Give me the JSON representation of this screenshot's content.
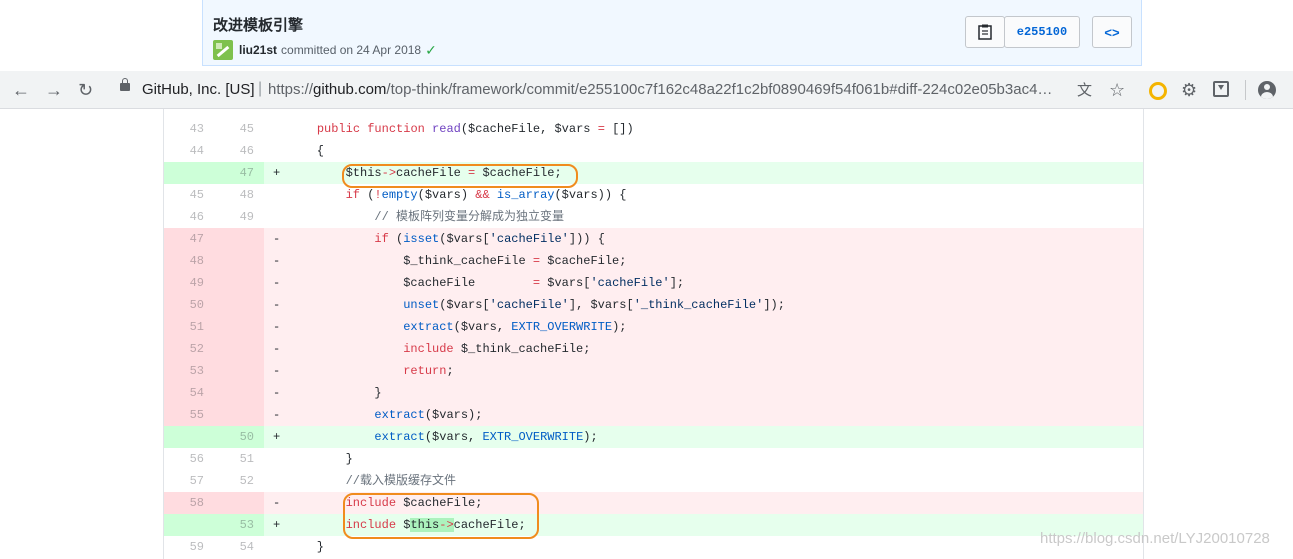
{
  "commit": {
    "title": "改进模板引擎",
    "author": "liu21st",
    "action": "committed on 24 Apr 2018",
    "sha": "e255100",
    "browse_label": "<>"
  },
  "browser": {
    "origin": "GitHub, Inc. [US]",
    "separator": "|",
    "url_prefix": "https://",
    "url_host": "github.com",
    "url_path": "/top-think/framework/commit/e255100c7f162c48a22f1c2bf0890469f54f061b#diff-224c02e05b3ac4…"
  },
  "diff": {
    "rows": [
      {
        "type": "ctx",
        "old": "43",
        "new": "45",
        "sign": "",
        "code": "    <span class=\"k\">public</span> <span class=\"k\">function</span> <span class=\"f\">read</span>($cacheFile, $vars <span class=\"k\">=</span> [])"
      },
      {
        "type": "ctx",
        "old": "44",
        "new": "46",
        "sign": "",
        "code": "    {"
      },
      {
        "type": "add",
        "old": "",
        "new": "47",
        "sign": "+",
        "code": "        $this<span class=\"k\">-&gt;</span>cacheFile <span class=\"k\">=</span> $cacheFile;"
      },
      {
        "type": "ctx",
        "old": "45",
        "new": "48",
        "sign": "",
        "code": "        <span class=\"k\">if</span> (<span class=\"k\">!</span><span class=\"n\">empty</span>($vars) <span class=\"k\">&amp;&amp;</span> <span class=\"n\">is_array</span>($vars)) {"
      },
      {
        "type": "ctx",
        "old": "46",
        "new": "49",
        "sign": "",
        "code": "            <span class=\"c\">// 模板阵列变量分解成为独立变量</span>"
      },
      {
        "type": "del",
        "old": "47",
        "new": "",
        "sign": "-",
        "code": "            <span class=\"k\">if</span> (<span class=\"n\">isset</span>($vars[<span class=\"s\">'cacheFile'</span>])) {"
      },
      {
        "type": "del",
        "old": "48",
        "new": "",
        "sign": "-",
        "code": "                $_think_cacheFile <span class=\"k\">=</span> $cacheFile;"
      },
      {
        "type": "del",
        "old": "49",
        "new": "",
        "sign": "-",
        "code": "                $cacheFile        <span class=\"k\">=</span> $vars[<span class=\"s\">'cacheFile'</span>];"
      },
      {
        "type": "del",
        "old": "50",
        "new": "",
        "sign": "-",
        "code": "                <span class=\"n\">unset</span>($vars[<span class=\"s\">'cacheFile'</span>], $vars[<span class=\"s\">'_think_cacheFile'</span>]);"
      },
      {
        "type": "del",
        "old": "51",
        "new": "",
        "sign": "-",
        "code": "                <span class=\"n\">extract</span>($vars, <span class=\"n\">EXTR_OVERWRITE</span>);"
      },
      {
        "type": "del",
        "old": "52",
        "new": "",
        "sign": "-",
        "code": "                <span class=\"k\">include</span> $_think_cacheFile;"
      },
      {
        "type": "del",
        "old": "53",
        "new": "",
        "sign": "-",
        "code": "                <span class=\"k\">return</span>;"
      },
      {
        "type": "del",
        "old": "54",
        "new": "",
        "sign": "-",
        "code": "            }"
      },
      {
        "type": "del",
        "old": "55",
        "new": "",
        "sign": "-",
        "code": "            <span class=\"n\">extract</span>($vars);"
      },
      {
        "type": "add",
        "old": "",
        "new": "50",
        "sign": "+",
        "code": "            <span class=\"n\">extract</span>($vars, <span class=\"n\">EXTR_OVERWRITE</span>);"
      },
      {
        "type": "ctx",
        "old": "56",
        "new": "51",
        "sign": "",
        "code": "        }"
      },
      {
        "type": "ctx",
        "old": "57",
        "new": "52",
        "sign": "",
        "code": "        <span class=\"c\">//载入模版缓存文件</span>"
      },
      {
        "type": "del",
        "old": "58",
        "new": "",
        "sign": "-",
        "code": "        <span class=\"k\">include</span> $cacheFile;"
      },
      {
        "type": "add",
        "old": "",
        "new": "53",
        "sign": "+",
        "code": "        <span class=\"k\">include</span> $<span class=\"hl\">this<span class=\"k\">-&gt;</span></span>cacheFile;"
      },
      {
        "type": "ctx",
        "old": "59",
        "new": "54",
        "sign": "",
        "code": "    }"
      }
    ]
  },
  "watermark": "https://blog.csdn.net/LYJ20010728"
}
